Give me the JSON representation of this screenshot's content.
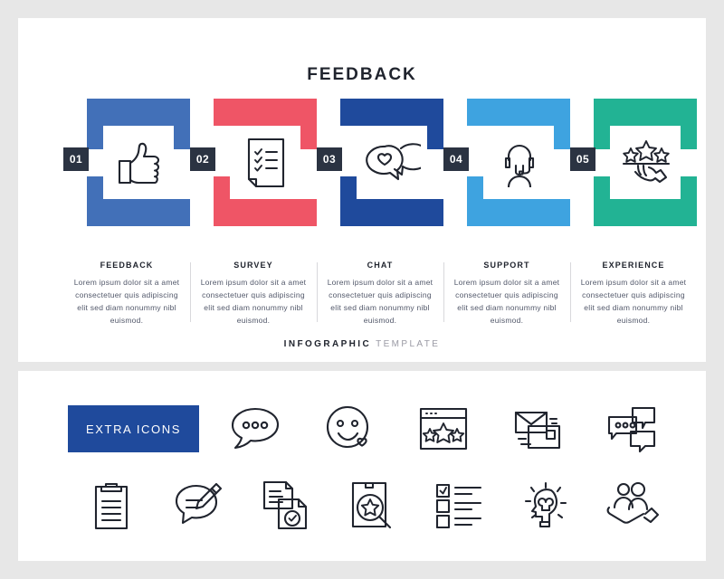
{
  "canvas": {
    "background": "#e7e7e7",
    "panel_background": "#ffffff"
  },
  "header": {
    "title": "FEEDBACK"
  },
  "footer": {
    "bold_word": "INFOGRAPHIC",
    "light_word": "TEMPLATE"
  },
  "body_text": "Lorem ipsum dolor sit a amet consectetuer quis adipiscing elit sed diam nonummy nibl euismod.",
  "steps": [
    {
      "number": "01",
      "label": "FEEDBACK",
      "color": "#4270b8",
      "icon": "thumbs-up-icon",
      "body": "Lorem ipsum dolor sit a amet consectetuer quis adipiscing elit sed diam nonummy nibl euismod."
    },
    {
      "number": "02",
      "label": "SURVEY",
      "color": "#ef5566",
      "icon": "checklist-document-icon",
      "body": "Lorem ipsum dolor sit a amet consectetuer quis adipiscing elit sed diam nonummy nibl euismod."
    },
    {
      "number": "03",
      "label": "CHAT",
      "color": "#1f4a9c",
      "icon": "heart-chat-bubble-icon",
      "body": "Lorem ipsum dolor sit a amet consectetuer quis adipiscing elit sed diam nonummy nibl euismod."
    },
    {
      "number": "04",
      "label": "SUPPORT",
      "color": "#3ea3e0",
      "icon": "headset-agent-icon",
      "body": "Lorem ipsum dolor sit a amet consectetuer quis adipiscing elit sed diam nonummy nibl euismod."
    },
    {
      "number": "05",
      "label": "EXPERIENCE",
      "color": "#22b394",
      "icon": "hand-star-rating-icon",
      "body": "Lorem ipsum dolor sit a amet consectetuer quis adipiscing elit sed diam nonummy nibl euismod."
    }
  ],
  "extra": {
    "box_label": "EXTRA ICONS",
    "box_color": "#1f4a9c",
    "row1": [
      {
        "icon": "chat-bubble-dots-icon"
      },
      {
        "icon": "smiley-heart-icon"
      },
      {
        "icon": "browser-star-rating-icon"
      },
      {
        "icon": "mail-envelope-stack-icon"
      },
      {
        "icon": "three-chat-bubbles-icon"
      }
    ],
    "row2": [
      {
        "icon": "clipboard-lines-icon"
      },
      {
        "icon": "chat-bubble-pencil-icon"
      },
      {
        "icon": "documents-check-icon"
      },
      {
        "icon": "document-star-search-icon"
      },
      {
        "icon": "checklist-icon"
      },
      {
        "icon": "head-lightbulb-idea-icon"
      },
      {
        "icon": "hand-holding-people-icon"
      }
    ]
  },
  "watermark": {
    "text": ""
  }
}
